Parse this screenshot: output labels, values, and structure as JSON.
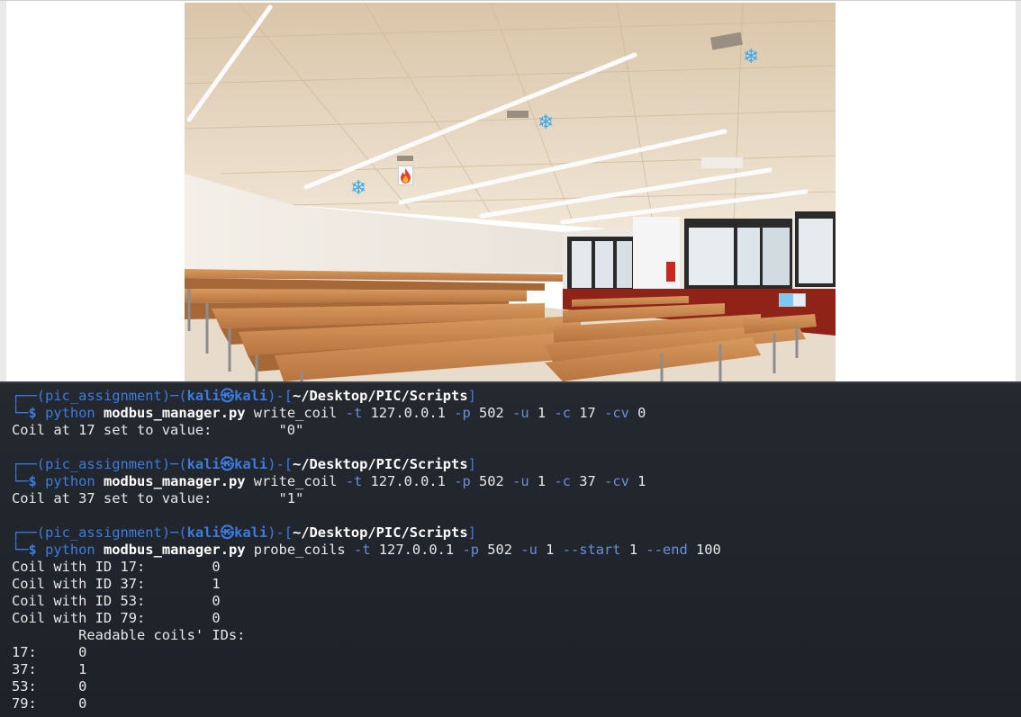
{
  "scene": {
    "description_icons": [
      "snowflake-icon",
      "snowflake-icon",
      "snowflake-icon",
      "fire-icon",
      "light-indicator"
    ],
    "colors": {
      "snowflake": "#3aa8ea",
      "fire": "#e4442a",
      "indicator": "#7cc8f2"
    }
  },
  "prompt": {
    "env": "pic_assignment",
    "user": "kali",
    "host": "kali",
    "path": "~/Desktop/PIC/Scripts"
  },
  "blocks": [
    {
      "cmd": {
        "py": "python",
        "script": "modbus_manager.py",
        "action": "write_coil",
        "args": [
          [
            "-t",
            "127.0.0.1"
          ],
          [
            "-p",
            "502"
          ],
          [
            "-u",
            "1"
          ],
          [
            "-c",
            "17"
          ],
          [
            "-cv",
            "0"
          ]
        ]
      },
      "output": [
        "Coil at 17 set to value:        \"0\""
      ]
    },
    {
      "cmd": {
        "py": "python",
        "script": "modbus_manager.py",
        "action": "write_coil",
        "args": [
          [
            "-t",
            "127.0.0.1"
          ],
          [
            "-p",
            "502"
          ],
          [
            "-u",
            "1"
          ],
          [
            "-c",
            "37"
          ],
          [
            "-cv",
            "1"
          ]
        ]
      },
      "output": [
        "Coil at 37 set to value:        \"1\""
      ]
    },
    {
      "cmd": {
        "py": "python",
        "script": "modbus_manager.py",
        "action": "probe_coils",
        "args": [
          [
            "-t",
            "127.0.0.1"
          ],
          [
            "-p",
            "502"
          ],
          [
            "-u",
            "1"
          ],
          [
            "--start",
            "1"
          ],
          [
            "--end",
            "100"
          ]
        ]
      },
      "output": [
        "Coil with ID 17:        0",
        "Coil with ID 37:        1",
        "Coil with ID 53:        0",
        "Coil with ID 79:        0",
        "        Readable coils' IDs:",
        "17:     0",
        "37:     1",
        "53:     0",
        "79:     0"
      ]
    }
  ]
}
